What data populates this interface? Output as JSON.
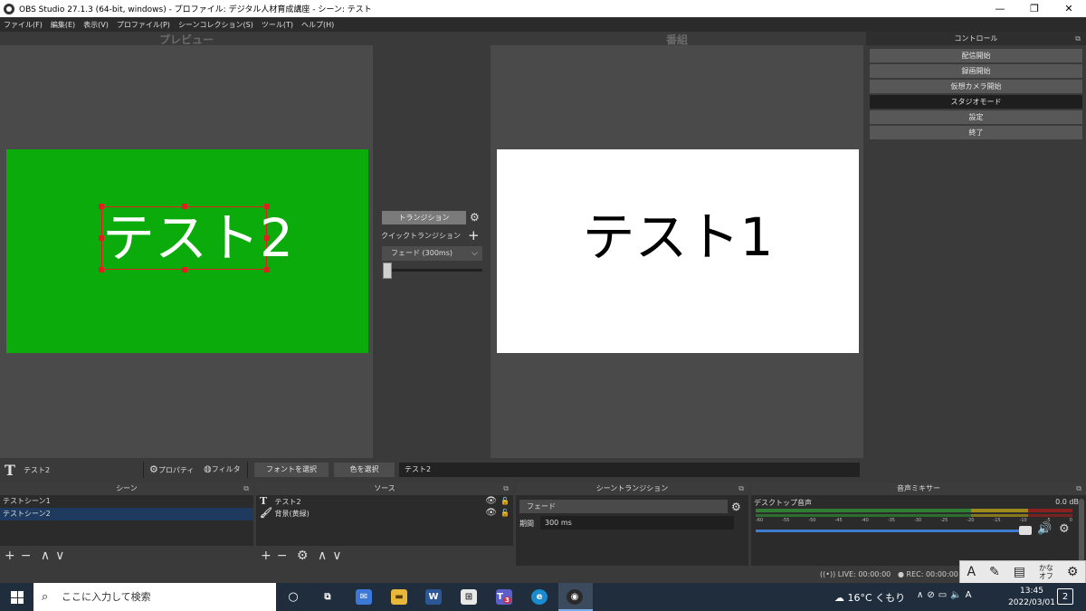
{
  "window": {
    "title": "OBS Studio 27.1.3 (64-bit, windows) - プロファイル: デジタル人材育成講座 - シーン: テスト",
    "minimize": "—",
    "restore": "❐",
    "close": "✕"
  },
  "menu": [
    "ファイル(F)",
    "編集(E)",
    "表示(V)",
    "プロファイル(P)",
    "シーンコレクション(S)",
    "ツール(T)",
    "ヘルプ(H)"
  ],
  "preview": {
    "label": "プレビュー",
    "text": "テスト2",
    "bg_color": "#0aab0a"
  },
  "program": {
    "label": "番組",
    "text": "テスト1"
  },
  "transition": {
    "button": "トランジション",
    "quick_label": "クイックトランジション",
    "select": "フェード (300ms)"
  },
  "controls": {
    "header": "コントロール",
    "buttons": [
      "配信開始",
      "録画開始",
      "仮想カメラ開始",
      "スタジオモード",
      "設定",
      "終了"
    ]
  },
  "props_bar": {
    "source_name": "テスト2",
    "properties": "プロパティ",
    "filters": "フィルタ",
    "font_button": "フォントを選択",
    "color_button": "色を選択",
    "text_value": "テスト2"
  },
  "scenes": {
    "header": "シーン",
    "items": [
      "テストシーン1",
      "テストシーン2"
    ]
  },
  "sources": {
    "header": "ソース",
    "items": [
      "テスト2",
      "背景(黄緑)"
    ]
  },
  "scene_transition": {
    "header": "シーントランジション",
    "select": "フェード",
    "duration_label": "期間",
    "duration_value": "300 ms"
  },
  "mixer": {
    "header": "音声ミキサー",
    "track": "デスクトップ音声",
    "db": "0.0 dB",
    "ticks": [
      "-60",
      "-55",
      "-50",
      "-45",
      "-40",
      "-35",
      "-30",
      "-25",
      "-20",
      "-15",
      "-10",
      "-5",
      "0"
    ]
  },
  "status": {
    "live": "LIVE: 00:00:00",
    "rec": "REC: 00:00:00"
  },
  "ime": {
    "mode": "A",
    "kana_top": "かな",
    "kana_bottom": "オフ"
  },
  "taskbar": {
    "search_placeholder": "ここに入力して検索",
    "weather": "16°C くもり",
    "ime_indicator": "A",
    "time": "13:45",
    "date": "2022/03/01",
    "notifications": "2",
    "teams_badge": "3"
  }
}
